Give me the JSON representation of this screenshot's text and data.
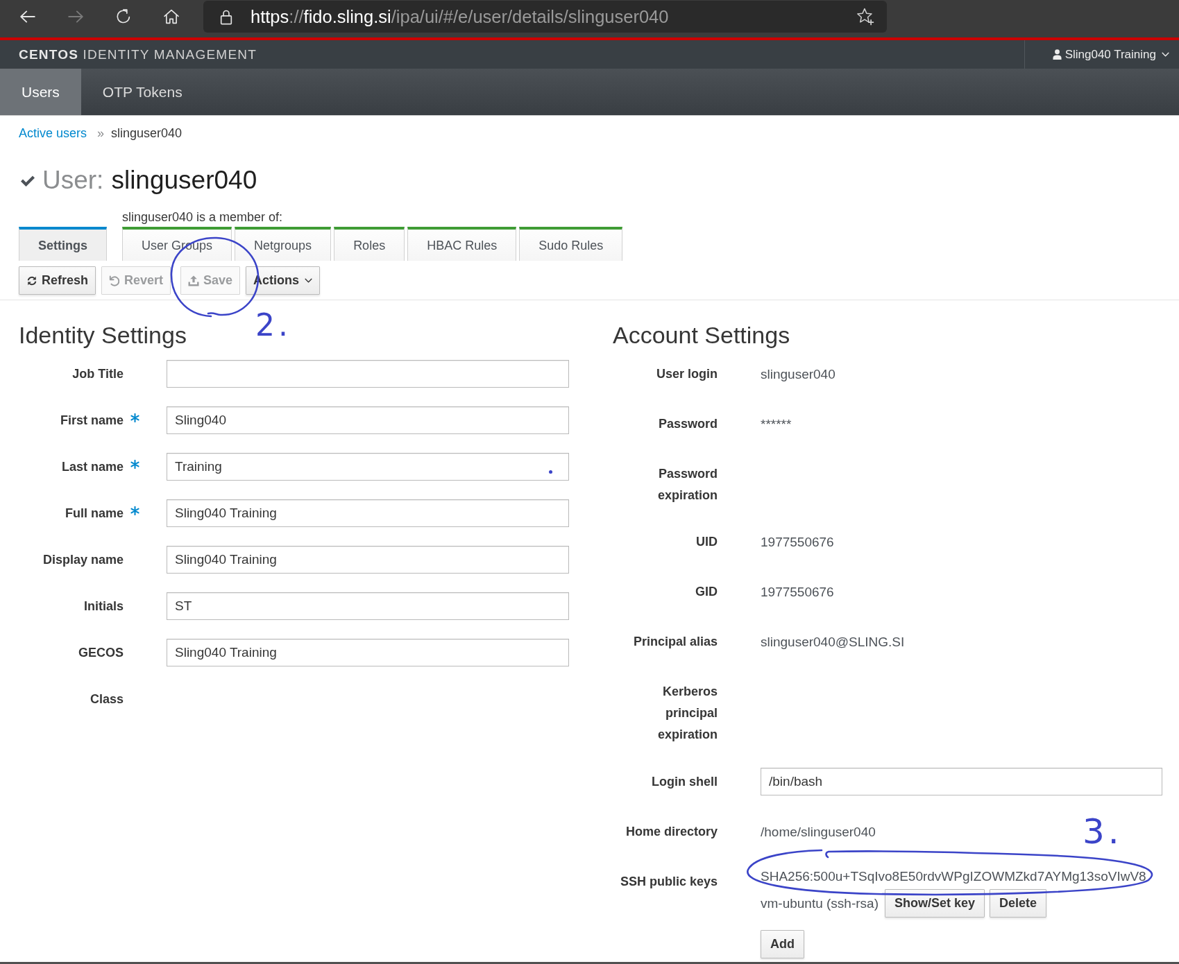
{
  "browser": {
    "nav_buttons": [
      {
        "kind": "back",
        "disabled": false
      },
      {
        "kind": "forward",
        "disabled": true
      },
      {
        "kind": "reload",
        "disabled": false
      },
      {
        "kind": "home",
        "disabled": false
      }
    ],
    "url": "**https**://**fido.sling.si**/ipa/ui/#/e/user/details/slinguser040"
  },
  "header": {
    "brand": "**CENTOS** IDENTITY MANAGEMENT",
    "user_menu": "Sling040 Training"
  },
  "nav": [
    {
      "label": "Users",
      "selected": true
    },
    {
      "label": "OTP Tokens",
      "selected": false
    }
  ],
  "breadcrumb": {
    "items": [
      {
        "label": "Active users",
        "kind": "link"
      },
      {
        "label": "slinguser040",
        "kind": "current"
      }
    ],
    "separator": "»"
  },
  "title": {
    "entity": "User:",
    "name": "slinguser040"
  },
  "member_of_label": "slinguser040 is a member of:",
  "tabs": [
    {
      "label": "Settings",
      "kind": "settings",
      "selected": true
    },
    {
      "label": "User Groups",
      "kind": "member",
      "selected": false
    },
    {
      "label": "Netgroups",
      "kind": "member",
      "selected": false
    },
    {
      "label": "Roles",
      "kind": "member",
      "selected": false
    },
    {
      "label": "HBAC Rules",
      "kind": "member",
      "selected": false
    },
    {
      "label": "Sudo Rules",
      "kind": "member",
      "selected": false
    }
  ],
  "toolbar": [
    {
      "label": "Refresh",
      "kind": "refresh",
      "disabled": false
    },
    {
      "label": "Revert",
      "kind": "revert",
      "disabled": true
    },
    {
      "label": "Save",
      "kind": "save",
      "disabled": true,
      "annotation": {
        "kind": "circle",
        "label": "2."
      }
    },
    {
      "label": "Actions",
      "kind": "dropdown",
      "disabled": false
    }
  ],
  "identity": {
    "title": "Identity Settings",
    "fields": [
      {
        "label": "Job Title",
        "kind": "input",
        "required": false
      },
      {
        "label": "First name",
        "kind": "input",
        "required": true,
        "value": "Sling040"
      },
      {
        "label": "Last name",
        "kind": "input",
        "required": true,
        "value": "Training",
        "annotation": {
          "kind": "dot"
        }
      },
      {
        "label": "Full name",
        "kind": "input",
        "required": true,
        "value": "Sling040 Training"
      },
      {
        "label": "Display name",
        "kind": "input",
        "required": false,
        "value": "Sling040 Training"
      },
      {
        "label": "Initials",
        "kind": "input",
        "required": false,
        "value": "ST"
      },
      {
        "label": "GECOS",
        "kind": "input",
        "required": false,
        "value": "Sling040 Training"
      },
      {
        "label": "Class",
        "kind": "static",
        "required": false
      }
    ]
  },
  "account": {
    "title": "Account Settings",
    "fields": [
      {
        "label": "User login",
        "kind": "static",
        "required": false,
        "value": "slinguser040"
      },
      {
        "label": "Password",
        "kind": "static",
        "required": false,
        "value": "******"
      },
      {
        "label": "Password expiration",
        "kind": "static",
        "required": false
      },
      {
        "label": "UID",
        "kind": "static",
        "required": false,
        "value": "1977550676"
      },
      {
        "label": "GID",
        "kind": "static",
        "required": false,
        "value": "1977550676"
      },
      {
        "label": "Principal alias",
        "kind": "static",
        "required": false,
        "value": "slinguser040@SLING.SI"
      },
      {
        "label": "Kerberos principal expiration",
        "kind": "static",
        "required": false
      },
      {
        "label": "Login shell",
        "kind": "input",
        "required": false,
        "value": "/bin/bash"
      },
      {
        "label": "Home directory",
        "kind": "static",
        "required": false,
        "value": "/home/slinguser040"
      },
      {
        "label": "SSH public keys",
        "kind": "ssh_keys",
        "required": false,
        "keys": [
          {
            "fingerprint": "SHA256:500u+TSqIvo8E50rdvWPgIZOWMZkd7AYMg13soVIwV8",
            "comment": "vm-ubuntu (ssh-rsa)",
            "actions": [
              "Show/Set key",
              "Delete"
            ],
            "annotation": {
              "kind": "circle",
              "label": "3."
            }
          }
        ],
        "add_label": "Add"
      }
    ]
  }
}
